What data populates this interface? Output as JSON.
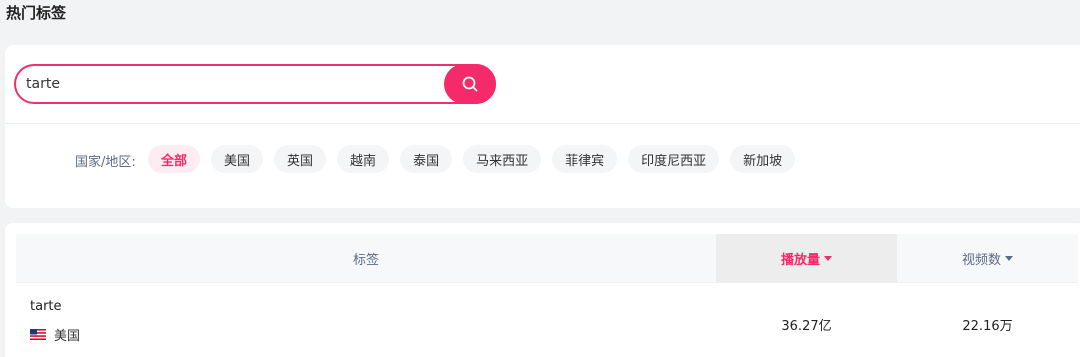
{
  "page": {
    "title": "热门标签"
  },
  "search": {
    "value": "tarte"
  },
  "filter": {
    "label": "国家/地区:",
    "chips": [
      {
        "label": "全部",
        "active": true
      },
      {
        "label": "美国"
      },
      {
        "label": "英国"
      },
      {
        "label": "越南"
      },
      {
        "label": "泰国"
      },
      {
        "label": "马来西亚"
      },
      {
        "label": "菲律宾"
      },
      {
        "label": "印度尼西亚"
      },
      {
        "label": "新加坡"
      }
    ]
  },
  "table": {
    "columns": {
      "tag": "标签",
      "plays": "播放量",
      "videos": "视频数"
    },
    "rows": [
      {
        "tag": "tarte",
        "region": "美国",
        "plays": "36.27亿",
        "videos": "22.16万"
      }
    ]
  },
  "colors": {
    "accent": "#f52a6a",
    "muted_text": "#5a6a85"
  },
  "icons": {
    "search": "search-icon",
    "sort": "caret-down-icon",
    "flag": "us-flag-icon"
  }
}
